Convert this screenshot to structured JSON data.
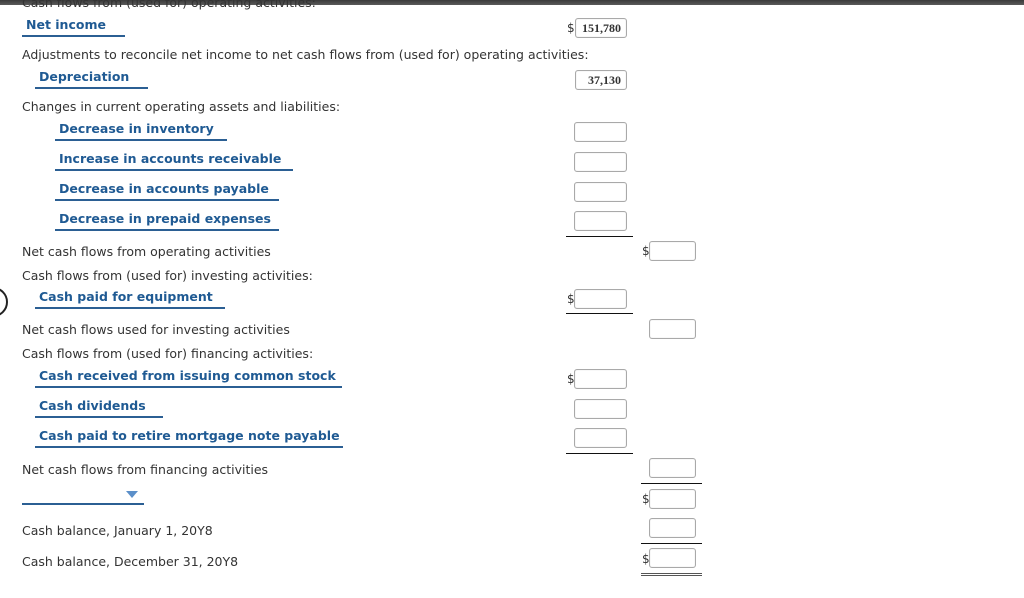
{
  "header": {
    "section_title_partial": "Cash flows from (used for) operating activities:"
  },
  "operating": {
    "net_income": {
      "label": "Net income",
      "value": "151,780",
      "currency": "$"
    },
    "adjustments_label": "Adjustments to reconcile net income to net cash flows from (used for) operating activities:",
    "depreciation": {
      "label": "Depreciation",
      "value": "37,130"
    },
    "changes_label": "Changes in current operating assets and liabilities:",
    "changes": [
      {
        "label": "Decrease in inventory",
        "value": ""
      },
      {
        "label": "Increase in accounts receivable",
        "value": ""
      },
      {
        "label": "Decrease in accounts payable",
        "value": ""
      },
      {
        "label": "Decrease in prepaid expenses",
        "value": ""
      }
    ],
    "net_label": "Net cash flows from operating activities",
    "net_value": "",
    "currency": "$"
  },
  "investing": {
    "heading": "Cash flows from (used for) investing activities:",
    "items": [
      {
        "label": "Cash paid for equipment",
        "value": "",
        "currency": "$"
      }
    ],
    "net_label": "Net cash flows used for investing activities",
    "net_value": ""
  },
  "financing": {
    "heading": "Cash flows from (used for) financing activities:",
    "items": [
      {
        "label": "Cash received from issuing common stock",
        "value": "",
        "currency": "$"
      },
      {
        "label": "Cash dividends",
        "value": ""
      },
      {
        "label": "Cash paid to retire mortgage note payable",
        "value": ""
      }
    ],
    "net_label": "Net cash flows from financing activities",
    "net_value": ""
  },
  "summary": {
    "change_dropdown": {
      "selected": "",
      "value": "",
      "currency": "$"
    },
    "jan_label": "Cash balance, January 1, 20Y8",
    "jan_value": "",
    "dec_label": "Cash balance, December 31, 20Y8",
    "dec_value": "",
    "currency": "$"
  }
}
